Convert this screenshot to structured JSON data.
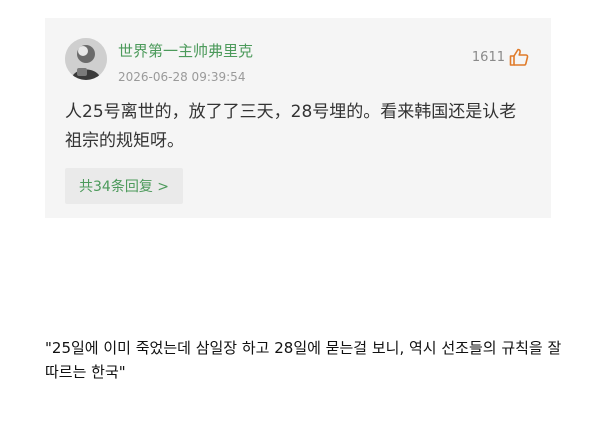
{
  "comment": {
    "username": "世界第一主帅弗里克",
    "timestamp": "2026-06-28 09:39:54",
    "likes": "1611",
    "body": "人25号离世的，放了了三天，28号埋的。看来韩国还是认老祖宗的规矩呀。",
    "replies_label": "共34条回复 >"
  },
  "translation": {
    "text": "\"25일에 이미 죽었는데 삼일장 하고 28일에 묻는걸 보니, 역시 선조들의 규칙을 잘 따르는 한국\""
  },
  "icons": {
    "avatar": "user-avatar",
    "like": "thumbs-up-icon"
  },
  "colors": {
    "username": "#4c9a5b",
    "replies": "#4c9a5b",
    "like_icon": "#e07b2a",
    "card_bg": "#f5f5f5"
  }
}
